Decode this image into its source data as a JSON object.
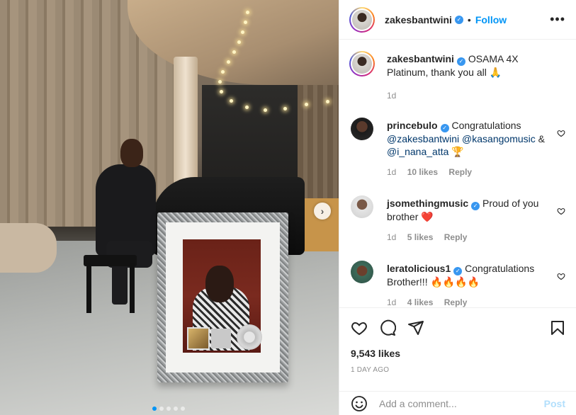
{
  "post": {
    "username": "zakesbantwini",
    "follow_label": "Follow",
    "separator": "•",
    "more_label": "•••",
    "next_label": "›",
    "caption_text": "OSAMA 4X Platinum, thank you all 🙏",
    "caption_time": "1d",
    "likes": "9,543 likes",
    "date": "1 DAY AGO",
    "carousel": {
      "count": 5,
      "active_index": 0
    }
  },
  "comments": [
    {
      "username": "princebulo",
      "text_parts": [
        {
          "t": "Congratulations ",
          "mention": false
        },
        {
          "t": "@zakesbantwini",
          "mention": true
        },
        {
          "t": " ",
          "mention": false
        },
        {
          "t": "@kasangomusic",
          "mention": true
        },
        {
          "t": " & ",
          "mention": false
        },
        {
          "t": "@i_nana_atta",
          "mention": true
        },
        {
          "t": " 🏆",
          "mention": false
        }
      ],
      "time": "1d",
      "likes": "10 likes",
      "reply_label": "Reply"
    },
    {
      "username": "jsomethingmusic",
      "text_parts": [
        {
          "t": "Proud of you brother ❤️",
          "mention": false
        }
      ],
      "time": "1d",
      "likes": "5 likes",
      "reply_label": "Reply"
    },
    {
      "username": "leratolicious1",
      "text_parts": [
        {
          "t": "Congratulations Brother!!! 🔥🔥🔥🔥",
          "mention": false
        }
      ],
      "time": "1d",
      "likes": "4 likes",
      "reply_label": "Reply"
    }
  ],
  "comment_box": {
    "placeholder": "Add a comment...",
    "post_label": "Post"
  },
  "colors": {
    "accent": "#0095f6",
    "verified": "#3897f0",
    "mention": "#00376b",
    "muted": "#8e8e8e",
    "post_disabled": "#b2dffc"
  },
  "icons": {
    "heart": "heart-icon",
    "comment": "comment-icon",
    "share": "share-icon",
    "save": "bookmark-icon",
    "emoji": "emoji-icon",
    "verified": "verified-badge-icon",
    "more": "more-options-icon",
    "next": "chevron-right-icon"
  }
}
